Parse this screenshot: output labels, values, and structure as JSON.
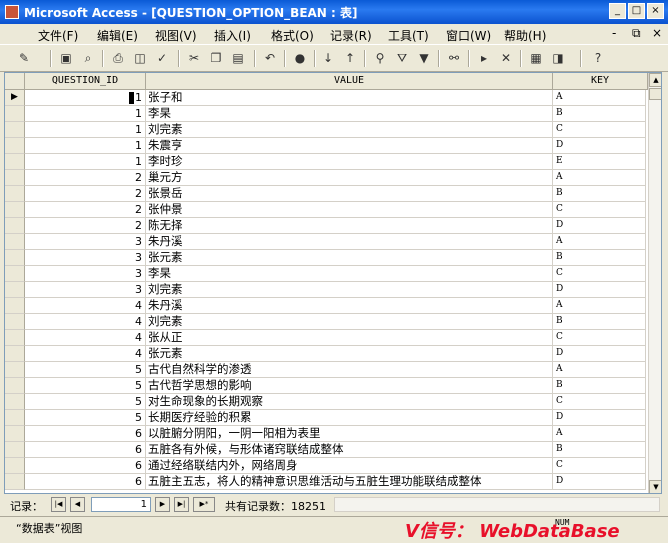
{
  "window": {
    "title": "Microsoft Access - [QUESTION_OPTION_BEAN : 表]",
    "controls": [
      "_",
      "□",
      "×"
    ]
  },
  "menu": [
    {
      "label": "文件(F)"
    },
    {
      "label": "编辑(E)"
    },
    {
      "label": "视图(V)"
    },
    {
      "label": "插入(I)"
    },
    {
      "label": "格式(O)"
    },
    {
      "label": "记录(R)"
    },
    {
      "label": "工具(T)"
    },
    {
      "label": "窗口(W)"
    },
    {
      "label": "帮助(H)"
    }
  ],
  "mdi_controls": [
    "-",
    "⧉",
    "×"
  ],
  "toolbar": {
    "icons": [
      "design-view-icon",
      "save-icon",
      "search-icon",
      "print-icon",
      "print-preview-icon",
      "spellcheck-icon",
      "cut-icon",
      "copy-icon",
      "paste-icon",
      "undo-icon",
      "insert-object-icon",
      "sort-ascending-icon",
      "sort-descending-icon",
      "filter-by-selection-icon",
      "filter-by-form-icon",
      "apply-filter-icon",
      "find-icon",
      "new-record-icon",
      "delete-record-icon",
      "database-window-icon",
      "new-object-icon",
      "help-icon"
    ]
  },
  "grid": {
    "columns": [
      "QUESTION_ID",
      "VALUE",
      "KEY"
    ],
    "rows": [
      {
        "id": "1",
        "value": "张子和",
        "key": "A"
      },
      {
        "id": "1",
        "value": "李杲",
        "key": "B"
      },
      {
        "id": "1",
        "value": "刘完素",
        "key": "C"
      },
      {
        "id": "1",
        "value": "朱震亨",
        "key": "D"
      },
      {
        "id": "1",
        "value": "李时珍",
        "key": "E"
      },
      {
        "id": "2",
        "value": "巢元方",
        "key": "A"
      },
      {
        "id": "2",
        "value": "张景岳",
        "key": "B"
      },
      {
        "id": "2",
        "value": "张仲景",
        "key": "C"
      },
      {
        "id": "2",
        "value": "陈无择",
        "key": "D"
      },
      {
        "id": "3",
        "value": "朱丹溪",
        "key": "A"
      },
      {
        "id": "3",
        "value": "张元素",
        "key": "B"
      },
      {
        "id": "3",
        "value": "李杲",
        "key": "C"
      },
      {
        "id": "3",
        "value": "刘完素",
        "key": "D"
      },
      {
        "id": "4",
        "value": "朱丹溪",
        "key": "A"
      },
      {
        "id": "4",
        "value": "刘完素",
        "key": "B"
      },
      {
        "id": "4",
        "value": "张从正",
        "key": "C"
      },
      {
        "id": "4",
        "value": "张元素",
        "key": "D"
      },
      {
        "id": "5",
        "value": "古代自然科学的渗透",
        "key": "A"
      },
      {
        "id": "5",
        "value": "古代哲学思想的影响",
        "key": "B"
      },
      {
        "id": "5",
        "value": "对生命现象的长期观察",
        "key": "C"
      },
      {
        "id": "5",
        "value": "长期医疗经验的积累",
        "key": "D"
      },
      {
        "id": "6",
        "value": "以脏腑分阴阳，一阴一阳相为表里",
        "key": "A"
      },
      {
        "id": "6",
        "value": "五脏各有外候，与形体诸窍联结成整体",
        "key": "B"
      },
      {
        "id": "6",
        "value": "通过经络联结内外，网络周身",
        "key": "C"
      },
      {
        "id": "6",
        "value": "五脏主五志，将人的精神意识思维活动与五脏生理功能联结成整体",
        "key": "D"
      }
    ]
  },
  "nav": {
    "label": "记录：",
    "current": "1",
    "count_text": "共有记录数：18251"
  },
  "status": {
    "view_text": "“数据表”视图",
    "num": "NUM"
  },
  "watermark": "V信号：  WebDataBase"
}
